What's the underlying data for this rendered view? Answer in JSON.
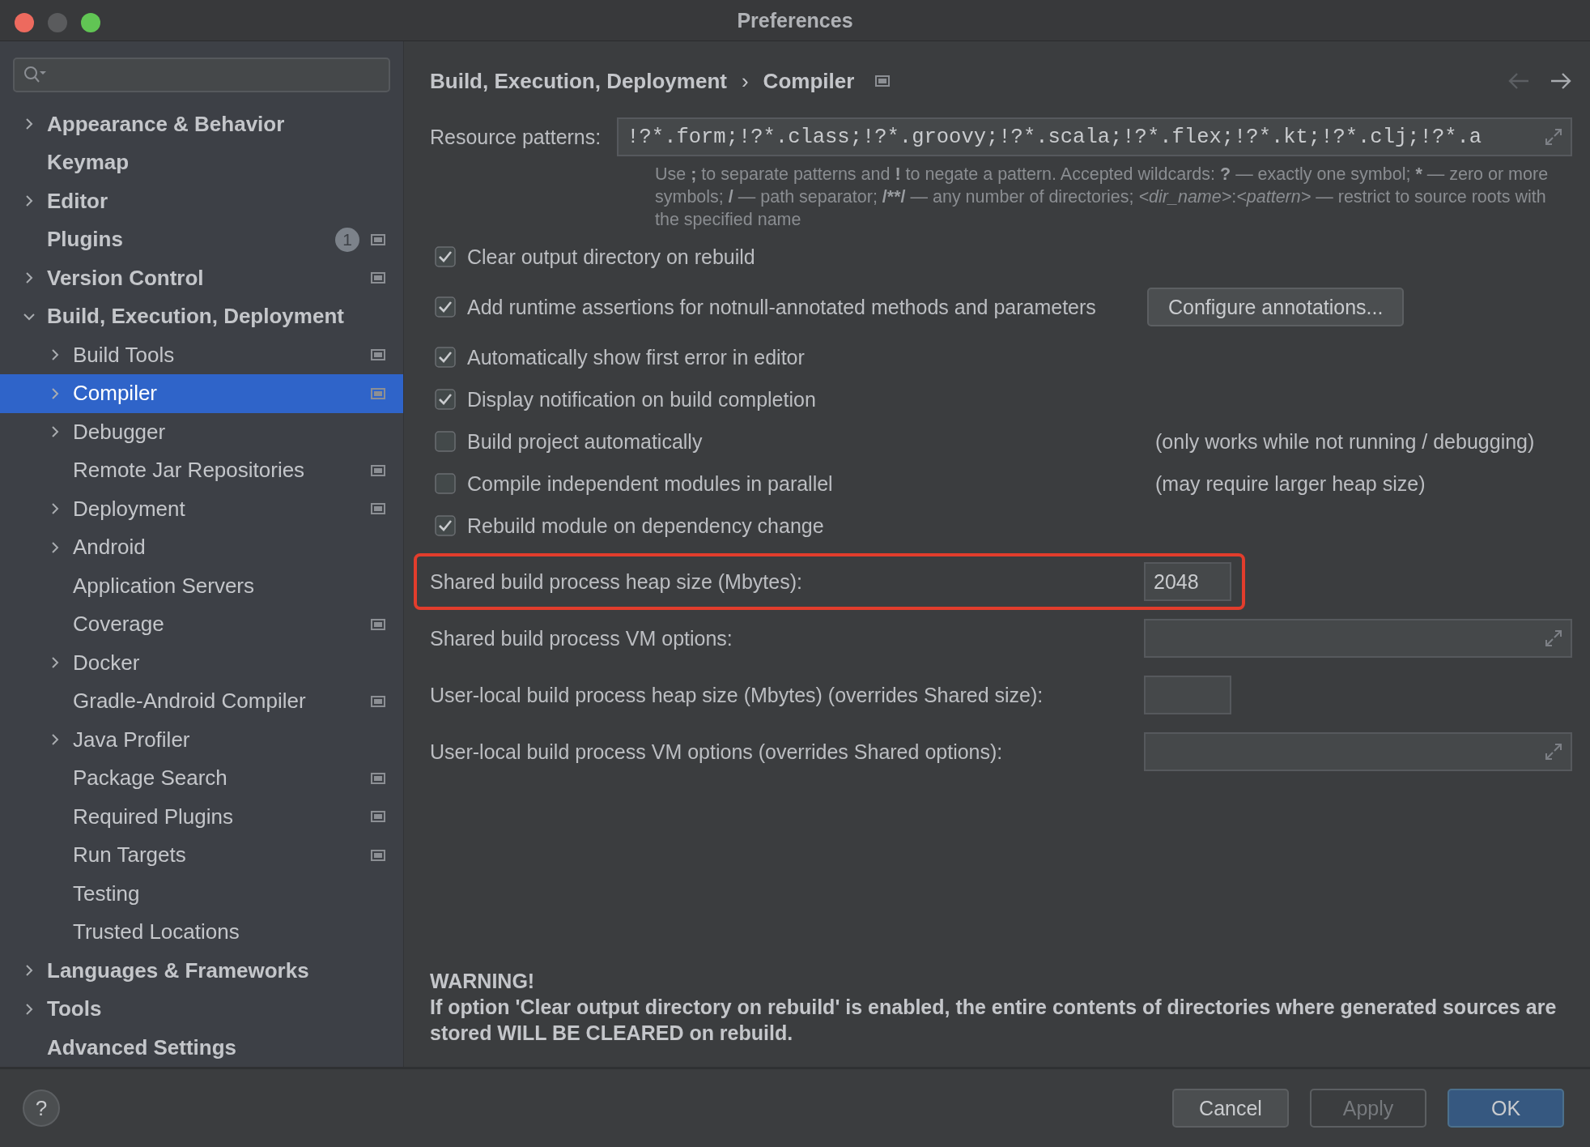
{
  "window": {
    "title": "Preferences",
    "controls": [
      {
        "color": "#ed6a5e"
      },
      {
        "color": "#5a5b5d"
      },
      {
        "color": "#61c554"
      }
    ]
  },
  "sidebar": {
    "items": [
      {
        "label": "Appearance & Behavior",
        "expandable": true,
        "selected": false
      },
      {
        "label": "Keymap",
        "selected": false
      },
      {
        "label": "Editor",
        "expandable": true,
        "selected": false
      },
      {
        "label": "Plugins",
        "selected": false,
        "project_scope": true,
        "badge": "1"
      },
      {
        "label": "Version Control",
        "expandable": true,
        "selected": false,
        "project_scope": true
      },
      {
        "label": "Build, Execution, Deployment",
        "expandable": true,
        "expanded": true,
        "selected": false,
        "children": [
          {
            "label": "Build Tools",
            "expandable": true,
            "selected": false,
            "project_scope": true
          },
          {
            "label": "Compiler",
            "expandable": true,
            "selected": true,
            "project_scope": true
          },
          {
            "label": "Debugger",
            "expandable": true,
            "selected": false
          },
          {
            "label": "Remote Jar Repositories",
            "selected": false,
            "project_scope": true
          },
          {
            "label": "Deployment",
            "expandable": true,
            "selected": false,
            "project_scope": true
          },
          {
            "label": "Android",
            "expandable": true,
            "selected": false
          },
          {
            "label": "Application Servers",
            "selected": false
          },
          {
            "label": "Coverage",
            "selected": false,
            "project_scope": true
          },
          {
            "label": "Docker",
            "expandable": true,
            "selected": false
          },
          {
            "label": "Gradle-Android Compiler",
            "selected": false,
            "project_scope": true
          },
          {
            "label": "Java Profiler",
            "expandable": true,
            "selected": false
          },
          {
            "label": "Package Search",
            "selected": false,
            "project_scope": true
          },
          {
            "label": "Required Plugins",
            "selected": false,
            "project_scope": true
          },
          {
            "label": "Run Targets",
            "selected": false,
            "project_scope": true
          },
          {
            "label": "Testing",
            "selected": false
          },
          {
            "label": "Trusted Locations",
            "selected": false
          }
        ]
      },
      {
        "label": "Languages & Frameworks",
        "expandable": true,
        "selected": false
      },
      {
        "label": "Tools",
        "expandable": true,
        "selected": false
      },
      {
        "label": "Advanced Settings",
        "selected": false
      }
    ]
  },
  "header": {
    "breadcrumb": [
      "Build, Execution, Deployment",
      "Compiler"
    ],
    "separator": "›",
    "project_scope": true,
    "nav": [
      {
        "kind": "back",
        "disabled": true
      },
      {
        "kind": "forward",
        "disabled": false
      }
    ]
  },
  "resource_patterns": {
    "label": "Resource patterns:",
    "value": "!?*.form;!?*.class;!?*.groovy;!?*.scala;!?*.flex;!?*.kt;!?*.clj;!?*.a",
    "help": [
      {
        "text": "Use ",
        "kind": "text"
      },
      {
        "text": ";",
        "kind": "symbol"
      },
      {
        "text": " to separate patterns and ",
        "kind": "text"
      },
      {
        "text": "!",
        "kind": "symbol"
      },
      {
        "text": " to negate a pattern. Accepted wildcards: ",
        "kind": "text"
      },
      {
        "text": "?",
        "kind": "symbol"
      },
      {
        "text": " — exactly one symbol; ",
        "kind": "text"
      },
      {
        "text": "*",
        "kind": "symbol"
      },
      {
        "text": " — zero or more symbols; ",
        "kind": "text"
      },
      {
        "text": "/",
        "kind": "symbol"
      },
      {
        "text": " — path separator; ",
        "kind": "text"
      },
      {
        "text": "/**/",
        "kind": "symbol"
      },
      {
        "text": " — any number of directories; ",
        "kind": "text"
      },
      {
        "text": "<dir_name>",
        "kind": "placeholder"
      },
      {
        "text": ":",
        "kind": "text"
      },
      {
        "text": "<pattern>",
        "kind": "placeholder"
      },
      {
        "text": " — restrict to source roots with the specified name",
        "kind": "text"
      }
    ]
  },
  "options": [
    {
      "label": "Clear output directory on rebuild",
      "checked": true
    },
    {
      "label": "Add runtime assertions for notnull-annotated methods and parameters",
      "checked": true,
      "button": "Configure annotations..."
    },
    {
      "label": "Automatically show first error in editor",
      "checked": true
    },
    {
      "label": "Display notification on build completion",
      "checked": true
    },
    {
      "label": "Build project automatically",
      "checked": false,
      "note": "(only works while not running / debugging)"
    },
    {
      "label": "Compile independent modules in parallel",
      "checked": false,
      "note": "(may require larger heap size)"
    },
    {
      "label": "Rebuild module on dependency change",
      "checked": true
    }
  ],
  "fields": [
    {
      "label": "Shared build process heap size (Mbytes):",
      "kind": "number",
      "value": "2048",
      "highlighted": true
    },
    {
      "label": "Shared build process VM options:",
      "kind": "text"
    },
    {
      "label": "User-local build process heap size (Mbytes) (overrides Shared size):",
      "kind": "number"
    },
    {
      "label": "User-local build process VM options (overrides Shared options):",
      "kind": "text"
    }
  ],
  "warning": {
    "title": "WARNING!",
    "text": "If option 'Clear output directory on rebuild' is enabled, the entire contents of directories where generated sources are stored WILL BE CLEARED on rebuild."
  },
  "footer": {
    "help": "?",
    "buttons": [
      {
        "label": "Cancel",
        "kind": "normal",
        "disabled": false
      },
      {
        "label": "Apply",
        "kind": "normal",
        "disabled": true
      },
      {
        "label": "OK",
        "kind": "default",
        "disabled": false
      }
    ]
  }
}
